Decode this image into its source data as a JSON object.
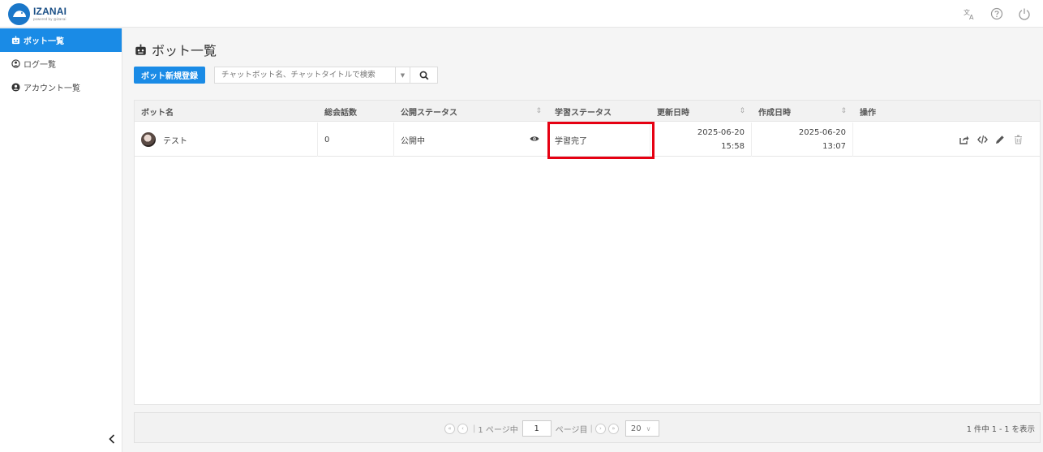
{
  "app": {
    "logo_title": "IZANAI",
    "logo_sub": "powered by @izanai"
  },
  "sidebar": {
    "items": [
      {
        "label": "ボット一覧",
        "icon": "robot-icon",
        "active": true
      },
      {
        "label": "ログ一覧",
        "icon": "log-circle-icon",
        "active": false
      },
      {
        "label": "アカウント一覧",
        "icon": "user-circle-icon",
        "active": false
      }
    ]
  },
  "page": {
    "title": "ボット一覧"
  },
  "toolbar": {
    "new_bot_label": "ボット新規登録",
    "search_placeholder": "チャットボット名、チャットタイトルで検索"
  },
  "table": {
    "headers": {
      "name": "ボット名",
      "total": "総会話数",
      "publish": "公開ステータス",
      "learning": "学習ステータス",
      "updated": "更新日時",
      "created": "作成日時",
      "ops": "操作"
    },
    "rows": [
      {
        "name": "テスト",
        "total": "0",
        "publish": "公開中",
        "learning": "学習完了",
        "updated_date": "2025-06-20",
        "updated_time": "15:58",
        "created_date": "2025-06-20",
        "created_time": "13:07"
      }
    ]
  },
  "pager": {
    "current_page": "1",
    "page_label_before": "1 ページ中",
    "page_label_after": "ページ目",
    "page_size": "20",
    "info": "1 件中 1 - 1 を表示"
  },
  "colors": {
    "primary": "#1a8be6",
    "highlight": "#e60012"
  }
}
